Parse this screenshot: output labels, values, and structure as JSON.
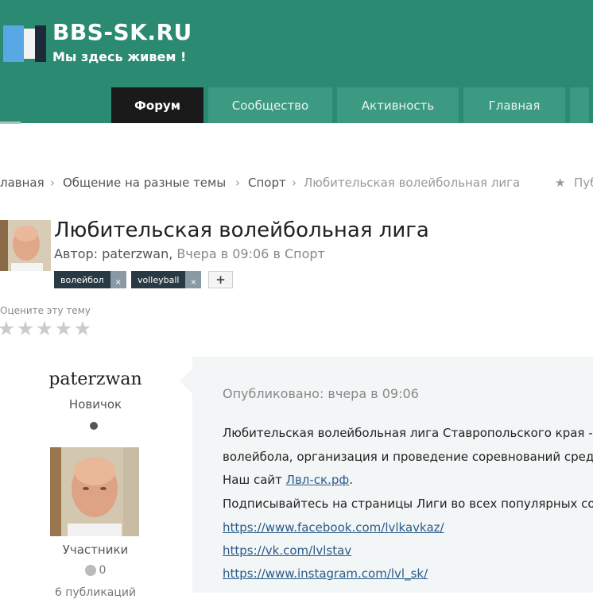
{
  "header": {
    "logo_title": "BBS-SK.RU",
    "logo_subtitle": "Мы здесь живем !",
    "nav": [
      {
        "label": "Форум",
        "active": true
      },
      {
        "label": "Сообщество",
        "active": false
      },
      {
        "label": "Активность",
        "active": false
      },
      {
        "label": "Главная",
        "active": false
      }
    ],
    "colors": {
      "header_bg": "#2b8a72",
      "tab_bg": "#3c9a82",
      "active_tab_bg": "#1a1a1a"
    }
  },
  "breadcrumb": {
    "items": [
      "лавная",
      "Общение на разные темы",
      "Спорт"
    ],
    "current": "Любительская волейбольная лига",
    "follow_label": "Пуб"
  },
  "topic": {
    "title": "Любительская волейбольная лига",
    "meta_author_prefix": "Автор: paterzwan,",
    "meta_time": "Вчера в 09:06",
    "meta_in": "в Спорт",
    "tags": [
      {
        "label": "волейбол",
        "remove": "×"
      },
      {
        "label": "volleyball",
        "remove": "×"
      }
    ],
    "add_tag_label": "+",
    "rate_label": "Оцените эту тему",
    "rating": 0,
    "rating_max": 5
  },
  "author": {
    "name": "paterzwan",
    "rank": "Новичок",
    "group": "Участники",
    "reputation": "0",
    "posts": "6 публикаций"
  },
  "post": {
    "published": "Опубликовано: вчера в 09:06",
    "line1": "Любительская волейбольная лига Ставропольского края - об",
    "line2": "волейбола, организация и проведение соревнований среди Л",
    "line3_prefix": "Наш сайт ",
    "line3_link": "Лвл-ск.рф",
    "line3_suffix": ".",
    "line4": "Подписывайтесь на страницы Лиги во всех популярных социа",
    "links": [
      "https://www.facebook.com/lvlkavkaz/",
      "https://vk.com/lvlstav",
      "https://www.instagram.com/lvl_sk/"
    ]
  }
}
